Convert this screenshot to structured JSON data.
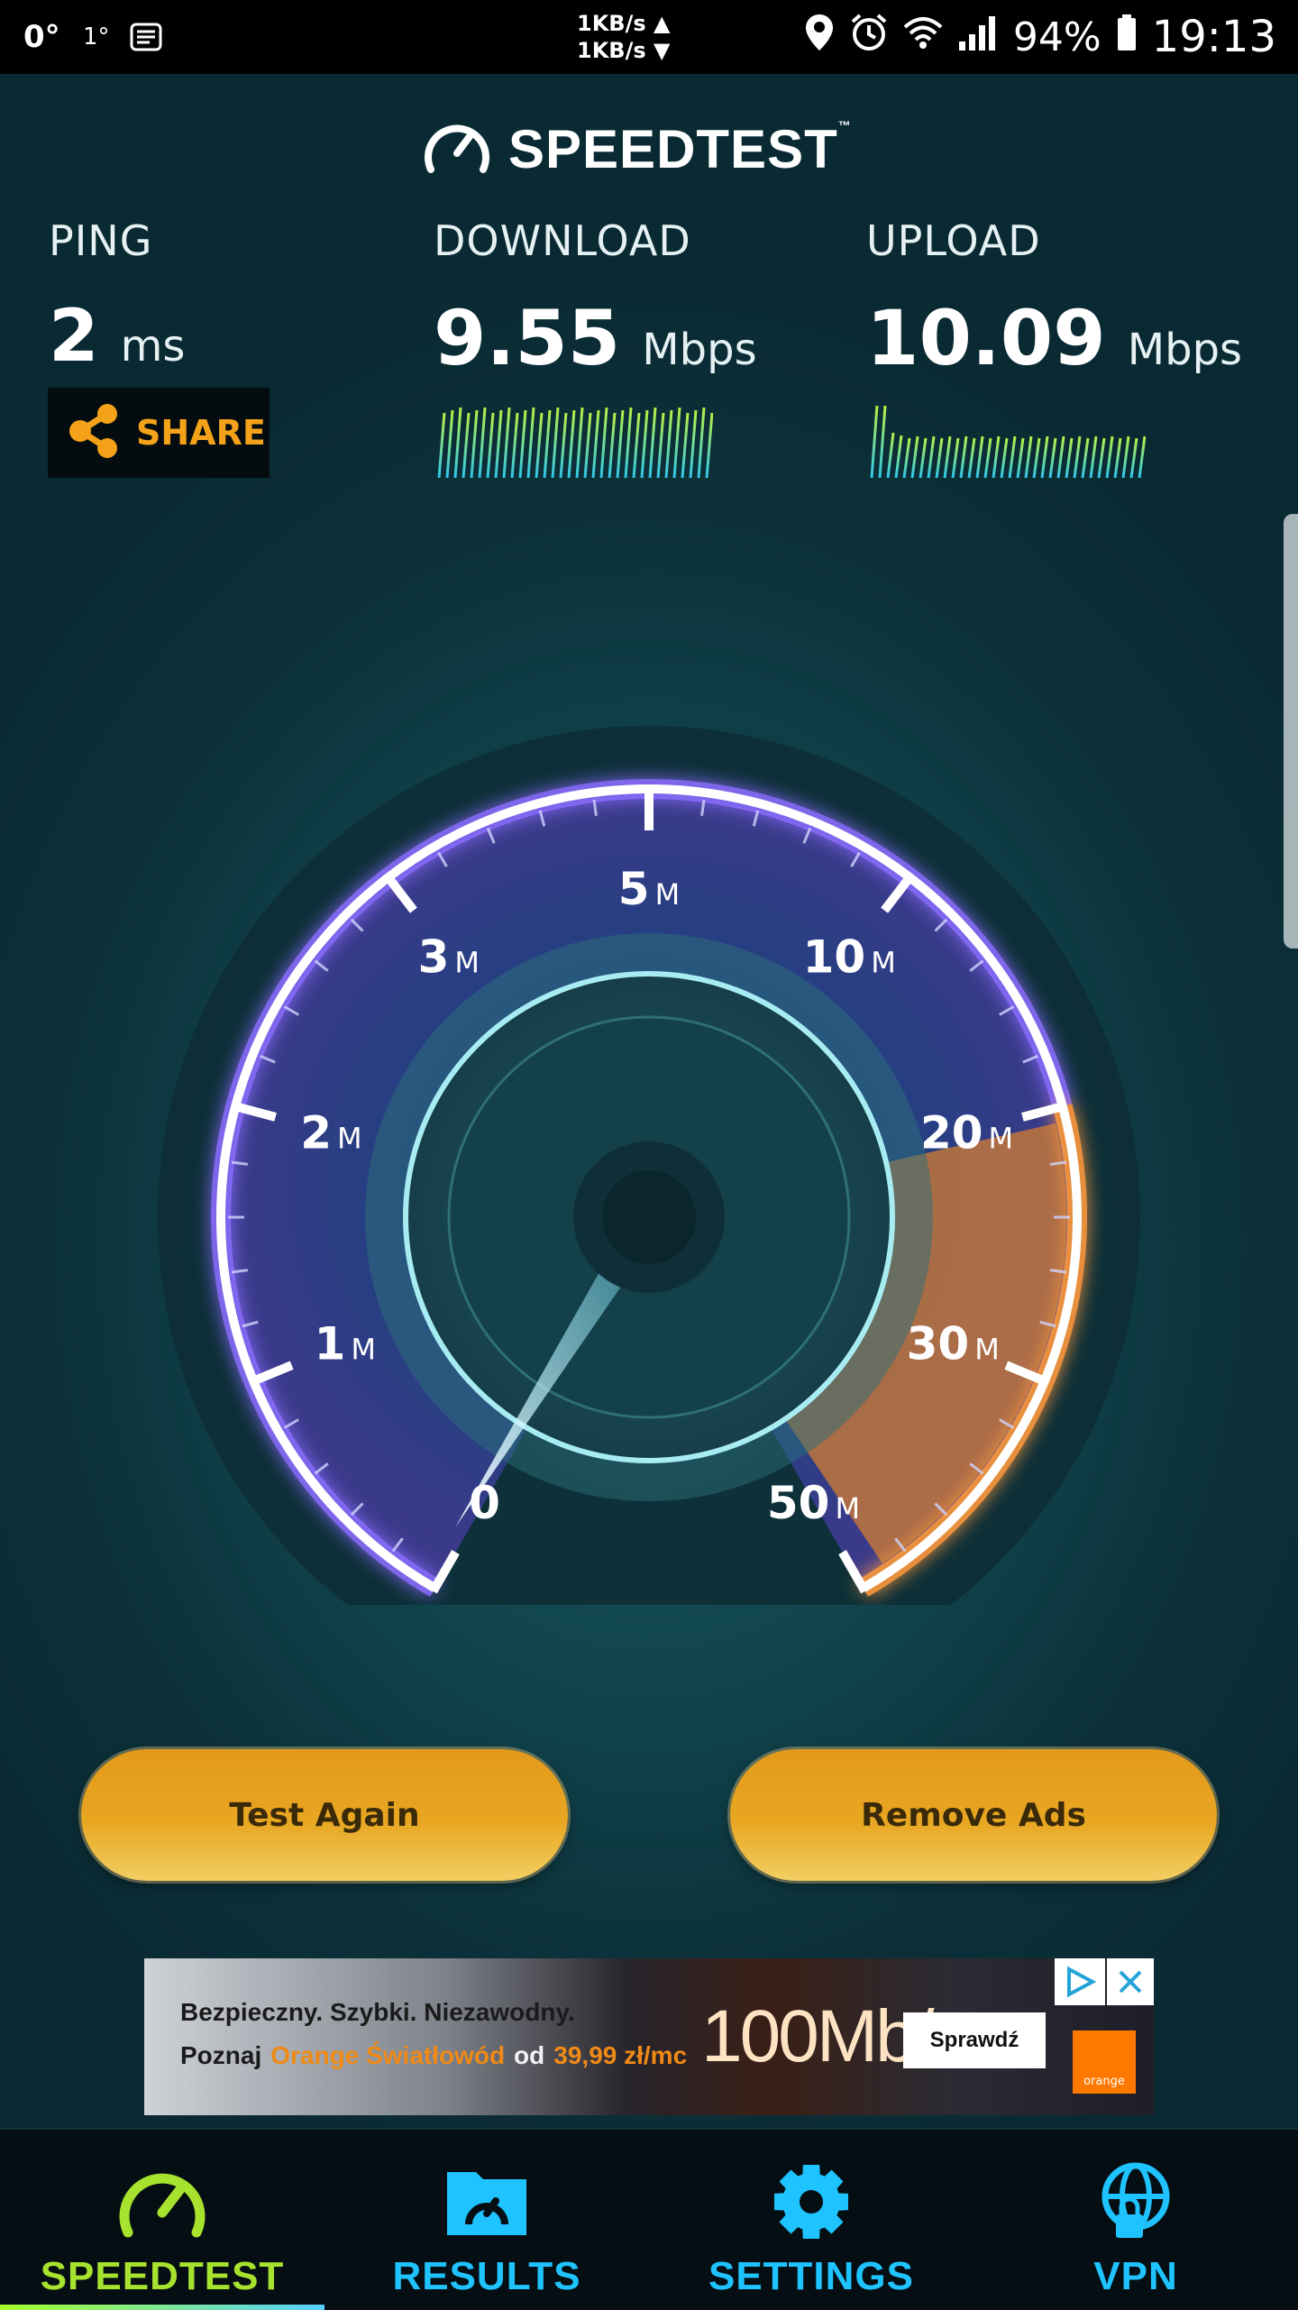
{
  "status_bar": {
    "temp1": "0°",
    "temp2": "1°",
    "net_up": "1KB/s ▲",
    "net_down": "1KB/s ▼",
    "battery": "94%",
    "time": "19:13"
  },
  "header": {
    "logo_text": "SPEEDTEST",
    "trademark": "™"
  },
  "metrics": {
    "ping": {
      "label": "PING",
      "value": "2",
      "unit": "ms"
    },
    "download": {
      "label": "DOWNLOAD",
      "value": "9.55",
      "unit": "Mbps"
    },
    "upload": {
      "label": "UPLOAD",
      "value": "10.09",
      "unit": "Mbps"
    }
  },
  "share": {
    "label": "SHARE"
  },
  "gauge": {
    "ticks": [
      {
        "num": "0",
        "unit": ""
      },
      {
        "num": "1",
        "unit": "M"
      },
      {
        "num": "2",
        "unit": "M"
      },
      {
        "num": "3",
        "unit": "M"
      },
      {
        "num": "5",
        "unit": "M"
      },
      {
        "num": "10",
        "unit": "M"
      },
      {
        "num": "20",
        "unit": "M"
      },
      {
        "num": "30",
        "unit": "M"
      },
      {
        "num": "50",
        "unit": "M"
      }
    ],
    "needle_tick": 0,
    "colors": {
      "ring": "#ffffff",
      "purple": "#8b6cff",
      "orange": "#ff9a3c",
      "teal": "#39d2e0"
    }
  },
  "actions": {
    "test_again": "Test Again",
    "remove_ads": "Remove Ads"
  },
  "ad": {
    "line1": "Bezpieczny. Szybki. Niezawodny.",
    "line2_a": "Poznaj",
    "line2_b": "Orange Światłowód",
    "line2_c": "od",
    "line2_d": "39,99 zł/mc",
    "speed": "100Mb/s",
    "cta": "Sprawdź",
    "brand": "orange"
  },
  "nav": {
    "items": [
      {
        "label": "SPEEDTEST",
        "icon": "gauge-icon",
        "active": true
      },
      {
        "label": "RESULTS",
        "icon": "folder-icon",
        "active": false
      },
      {
        "label": "SETTINGS",
        "icon": "gear-icon",
        "active": false
      },
      {
        "label": "VPN",
        "icon": "globe-lock-icon",
        "active": false
      }
    ],
    "colors": {
      "active": "#a6e22e",
      "inactive": "#1fc3ff"
    }
  }
}
